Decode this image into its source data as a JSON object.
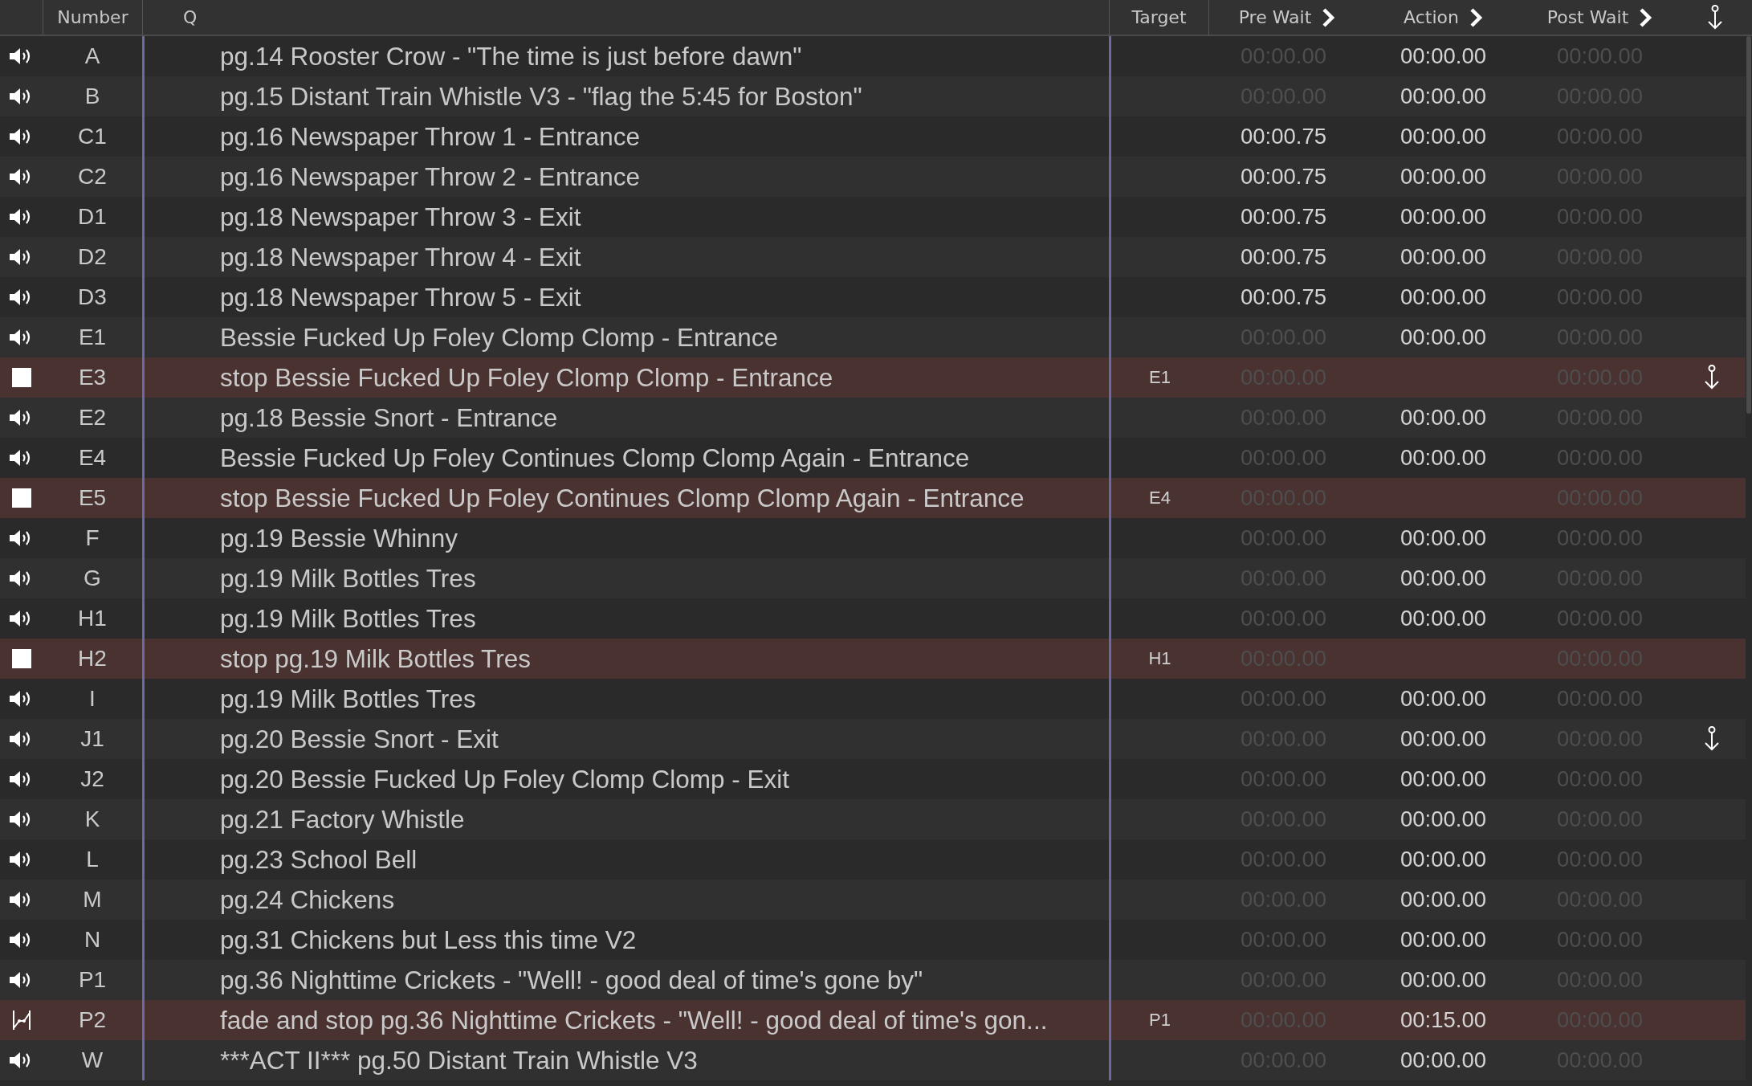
{
  "columns": {
    "number": "Number",
    "q": "Q",
    "target": "Target",
    "pre_wait": "Pre Wait",
    "action": "Action",
    "post_wait": "Post Wait"
  },
  "rows": [
    {
      "kind": "audio",
      "number": "A",
      "q": "pg.14 Rooster Crow - \"The time is just before dawn\"",
      "pre_wait": {
        "text": "00:00.00",
        "muted": true
      },
      "action": "00:00.00",
      "post_wait": {
        "text": "00:00.00",
        "muted": true
      },
      "auto_continue": false
    },
    {
      "kind": "audio",
      "number": "B",
      "q": "pg.15 Distant Train Whistle V3 - \"flag the 5:45 for Boston\"",
      "pre_wait": {
        "text": "00:00.00",
        "muted": true
      },
      "action": "00:00.00",
      "post_wait": {
        "text": "00:00.00",
        "muted": true
      },
      "auto_continue": false
    },
    {
      "kind": "audio",
      "number": "C1",
      "q": "pg.16 Newspaper Throw 1 - Entrance",
      "pre_wait": {
        "text": "00:00.75",
        "muted": false
      },
      "action": "00:00.00",
      "post_wait": {
        "text": "00:00.00",
        "muted": true
      },
      "auto_continue": false
    },
    {
      "kind": "audio",
      "number": "C2",
      "q": "pg.16 Newspaper Throw 2 - Entrance",
      "pre_wait": {
        "text": "00:00.75",
        "muted": false
      },
      "action": "00:00.00",
      "post_wait": {
        "text": "00:00.00",
        "muted": true
      },
      "auto_continue": false
    },
    {
      "kind": "audio",
      "number": "D1",
      "q": "pg.18 Newspaper Throw 3 - Exit",
      "pre_wait": {
        "text": "00:00.75",
        "muted": false
      },
      "action": "00:00.00",
      "post_wait": {
        "text": "00:00.00",
        "muted": true
      },
      "auto_continue": false
    },
    {
      "kind": "audio",
      "number": "D2",
      "q": "pg.18 Newspaper Throw 4 - Exit",
      "pre_wait": {
        "text": "00:00.75",
        "muted": false
      },
      "action": "00:00.00",
      "post_wait": {
        "text": "00:00.00",
        "muted": true
      },
      "auto_continue": false
    },
    {
      "kind": "audio",
      "number": "D3",
      "q": "pg.18 Newspaper Throw 5 - Exit",
      "pre_wait": {
        "text": "00:00.75",
        "muted": false
      },
      "action": "00:00.00",
      "post_wait": {
        "text": "00:00.00",
        "muted": true
      },
      "auto_continue": false
    },
    {
      "kind": "audio",
      "number": "E1",
      "q": "Bessie Fucked Up Foley Clomp Clomp - Entrance",
      "pre_wait": {
        "text": "00:00.00",
        "muted": true
      },
      "action": "00:00.00",
      "post_wait": {
        "text": "00:00.00",
        "muted": true
      },
      "auto_continue": false
    },
    {
      "kind": "stop",
      "number": "E3",
      "q": "stop Bessie Fucked Up Foley Clomp Clomp - Entrance",
      "target": "E1",
      "pre_wait": {
        "text": "00:00.00",
        "muted": true
      },
      "post_wait": {
        "text": "00:00.00",
        "muted": true
      },
      "auto_continue": true
    },
    {
      "kind": "audio",
      "number": "E2",
      "q": "pg.18 Bessie Snort - Entrance",
      "pre_wait": {
        "text": "00:00.00",
        "muted": true
      },
      "action": "00:00.00",
      "post_wait": {
        "text": "00:00.00",
        "muted": true
      },
      "auto_continue": false
    },
    {
      "kind": "audio",
      "number": "E4",
      "q": "Bessie Fucked Up Foley Continues Clomp Clomp Again - Entrance",
      "pre_wait": {
        "text": "00:00.00",
        "muted": true
      },
      "action": "00:00.00",
      "post_wait": {
        "text": "00:00.00",
        "muted": true
      },
      "auto_continue": false
    },
    {
      "kind": "stop",
      "number": "E5",
      "q": "stop Bessie Fucked Up Foley Continues Clomp Clomp Again - Entrance",
      "target": "E4",
      "pre_wait": {
        "text": "00:00.00",
        "muted": true
      },
      "post_wait": {
        "text": "00:00.00",
        "muted": true
      },
      "auto_continue": false
    },
    {
      "kind": "audio",
      "number": "F",
      "q": "pg.19 Bessie Whinny",
      "pre_wait": {
        "text": "00:00.00",
        "muted": true
      },
      "action": "00:00.00",
      "post_wait": {
        "text": "00:00.00",
        "muted": true
      },
      "auto_continue": false
    },
    {
      "kind": "audio",
      "number": "G",
      "q": "pg.19 Milk Bottles Tres",
      "pre_wait": {
        "text": "00:00.00",
        "muted": true
      },
      "action": "00:00.00",
      "post_wait": {
        "text": "00:00.00",
        "muted": true
      },
      "auto_continue": false
    },
    {
      "kind": "audio",
      "number": "H1",
      "q": "pg.19 Milk Bottles Tres",
      "pre_wait": {
        "text": "00:00.00",
        "muted": true
      },
      "action": "00:00.00",
      "post_wait": {
        "text": "00:00.00",
        "muted": true
      },
      "auto_continue": false
    },
    {
      "kind": "stop",
      "number": "H2",
      "q": "stop pg.19 Milk Bottles Tres",
      "target": "H1",
      "pre_wait": {
        "text": "00:00.00",
        "muted": true
      },
      "post_wait": {
        "text": "00:00.00",
        "muted": true
      },
      "auto_continue": false
    },
    {
      "kind": "audio",
      "number": "I",
      "q": "pg.19 Milk Bottles Tres",
      "pre_wait": {
        "text": "00:00.00",
        "muted": true
      },
      "action": "00:00.00",
      "post_wait": {
        "text": "00:00.00",
        "muted": true
      },
      "auto_continue": false
    },
    {
      "kind": "audio",
      "number": "J1",
      "q": "pg.20 Bessie Snort - Exit",
      "pre_wait": {
        "text": "00:00.00",
        "muted": true
      },
      "action": "00:00.00",
      "post_wait": {
        "text": "00:00.00",
        "muted": true
      },
      "auto_continue": true
    },
    {
      "kind": "audio",
      "number": "J2",
      "q": "pg.20 Bessie Fucked Up Foley Clomp Clomp - Exit",
      "pre_wait": {
        "text": "00:00.00",
        "muted": true
      },
      "action": "00:00.00",
      "post_wait": {
        "text": "00:00.00",
        "muted": true
      },
      "auto_continue": false
    },
    {
      "kind": "audio",
      "number": "K",
      "q": "pg.21 Factory Whistle",
      "pre_wait": {
        "text": "00:00.00",
        "muted": true
      },
      "action": "00:00.00",
      "post_wait": {
        "text": "00:00.00",
        "muted": true
      },
      "auto_continue": false
    },
    {
      "kind": "audio",
      "number": "L",
      "q": "pg.23 School Bell",
      "pre_wait": {
        "text": "00:00.00",
        "muted": true
      },
      "action": "00:00.00",
      "post_wait": {
        "text": "00:00.00",
        "muted": true
      },
      "auto_continue": false
    },
    {
      "kind": "audio",
      "number": "M",
      "q": "pg.24 Chickens",
      "pre_wait": {
        "text": "00:00.00",
        "muted": true
      },
      "action": "00:00.00",
      "post_wait": {
        "text": "00:00.00",
        "muted": true
      },
      "auto_continue": false
    },
    {
      "kind": "audio",
      "number": "N",
      "q": "pg.31 Chickens but Less this time V2",
      "pre_wait": {
        "text": "00:00.00",
        "muted": true
      },
      "action": "00:00.00",
      "post_wait": {
        "text": "00:00.00",
        "muted": true
      },
      "auto_continue": false
    },
    {
      "kind": "audio",
      "number": "P1",
      "q": "pg.36 Nighttime Crickets - \"Well! - good deal of time's gone by\"",
      "pre_wait": {
        "text": "00:00.00",
        "muted": true
      },
      "action": "00:00.00",
      "post_wait": {
        "text": "00:00.00",
        "muted": true
      },
      "auto_continue": false
    },
    {
      "kind": "fade",
      "number": "P2",
      "q": "fade and stop pg.36 Nighttime Crickets - \"Well! - good deal of time's gon...",
      "target": "P1",
      "pre_wait": {
        "text": "00:00.00",
        "muted": true
      },
      "action": "00:15.00",
      "post_wait": {
        "text": "00:00.00",
        "muted": true
      },
      "auto_continue": false
    },
    {
      "kind": "audio",
      "number": "W",
      "q": "***ACT II*** pg.50 Distant Train Whistle V3",
      "pre_wait": {
        "text": "00:00.00",
        "muted": true
      },
      "action": "00:00.00",
      "post_wait": {
        "text": "00:00.00",
        "muted": true
      },
      "auto_continue": false
    }
  ]
}
